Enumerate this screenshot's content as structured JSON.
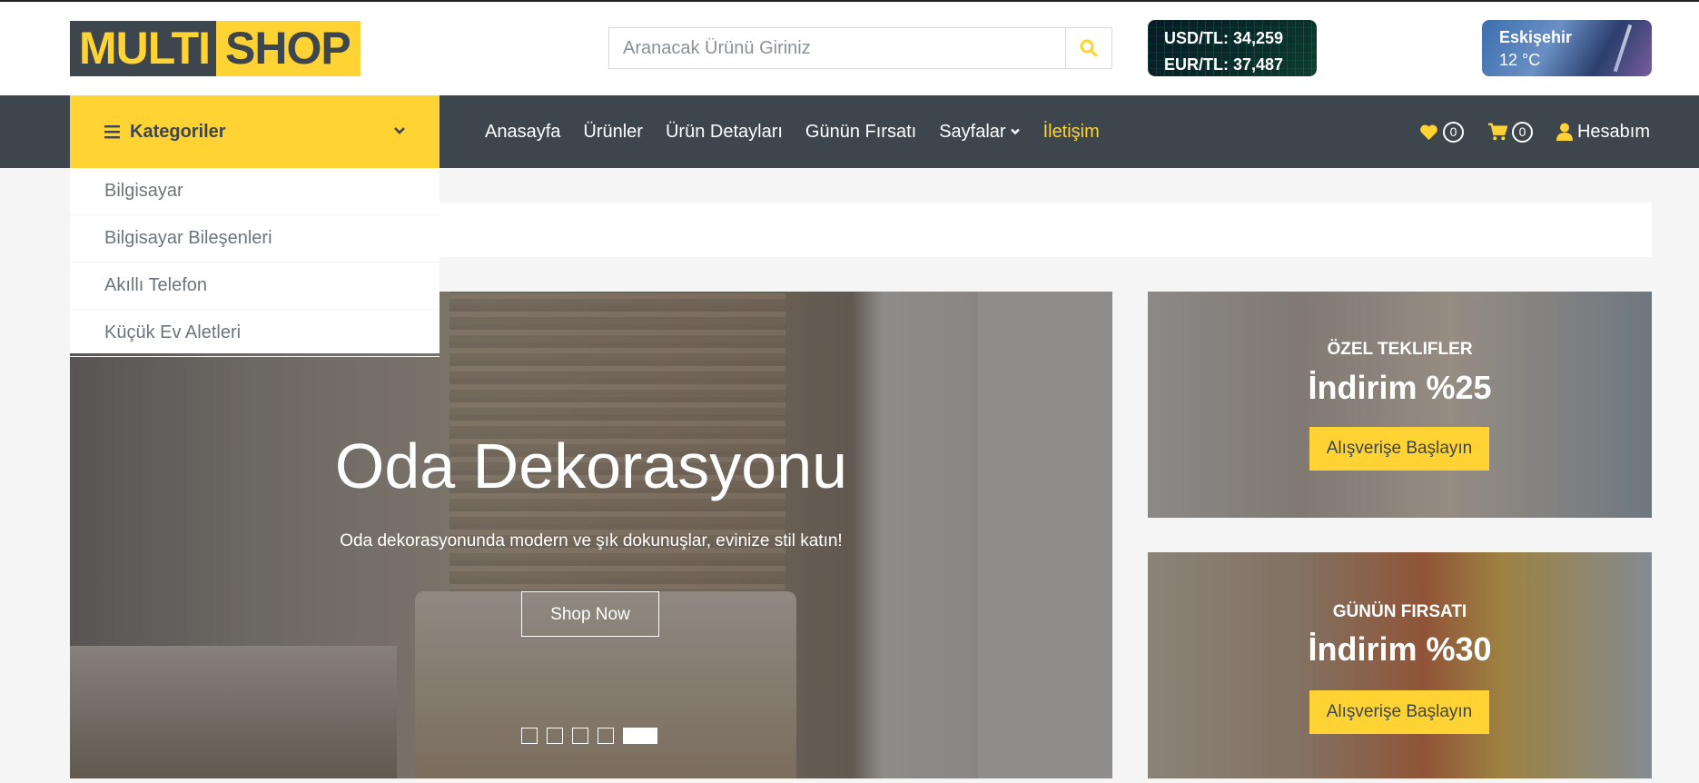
{
  "logo": {
    "part1": "MULTI",
    "part2": "SHOP"
  },
  "search": {
    "placeholder": "Aranacak Ürünü Giriniz"
  },
  "currency": {
    "usd": "USD/TL: 34,259",
    "eur": "EUR/TL: 37,487"
  },
  "weather": {
    "city": "Eskişehir",
    "temp": "12 °C"
  },
  "categories": {
    "label": "Kategoriler",
    "items": [
      "Bilgisayar",
      "Bilgisayar Bileşenleri",
      "Akıllı Telefon",
      "Küçük Ev Aletleri"
    ]
  },
  "nav": {
    "items": [
      "Anasayfa",
      "Ürünler",
      "Ürün Detayları",
      "Günün Fırsatı",
      "Sayfalar",
      "İletişim"
    ]
  },
  "header_icons": {
    "wishlist_count": "0",
    "cart_count": "0",
    "account_label": "Hesabım"
  },
  "hero": {
    "title": "Oda Dekorasyonu",
    "subtitle": "Oda dekorasyonunda modern ve şık dokunuşlar, evinize stil katın!",
    "button": "Shop Now"
  },
  "offers": [
    {
      "kicker": "ÖZEL TEKLIFLER",
      "headline": "İndirim %25",
      "button": "Alışverişe Başlayın"
    },
    {
      "kicker": "GÜNÜN FIRSATI",
      "headline": "İndirim %30",
      "button": "Alışverişe Başlayın"
    }
  ],
  "colors": {
    "accent": "#ffd333",
    "dark": "#3d464d",
    "background": "#f5f5f5"
  }
}
